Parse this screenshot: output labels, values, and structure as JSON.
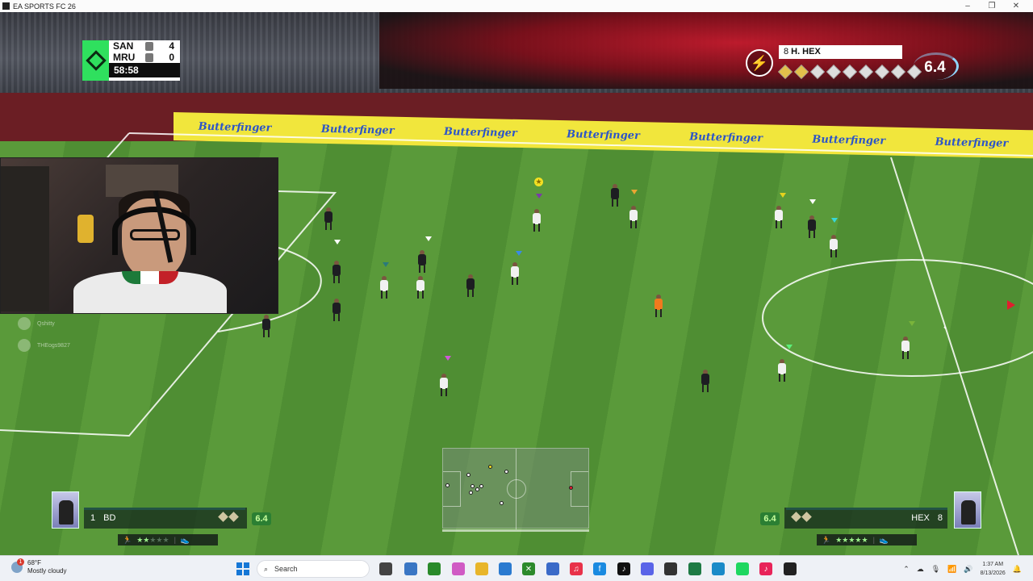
{
  "window": {
    "title": "EA SPORTS FC 26",
    "minimize": "–",
    "maximize": "❐",
    "close": "✕"
  },
  "scoreboard": {
    "home": {
      "team": "SAN",
      "score": "4"
    },
    "away": {
      "team": "MRU",
      "score": "0"
    },
    "clock": "58:58"
  },
  "player_rating": {
    "number": "8",
    "name": "H. HEX",
    "rating": "6.4",
    "icon": "lightning-icon"
  },
  "adboard": {
    "brand": "Butterfinger"
  },
  "chat": [
    {
      "user": "Qshitty"
    },
    {
      "user": "THEogs9827"
    }
  ],
  "hud_left": {
    "number": "1",
    "name": "BD",
    "rating": "6.4",
    "stars": "★★",
    "empty_stars": "★★★"
  },
  "hud_right": {
    "number": "8",
    "name": "HEX",
    "rating": "6.4",
    "stars": "★★★★★"
  },
  "taskbar": {
    "weather_temp": "68°F",
    "weather_desc": "Mostly cloudy",
    "notification_count": "1",
    "search_placeholder": "Search",
    "time": "1:37 AM",
    "date": "8/13/2026"
  },
  "colors": {
    "accent_green": "#2fe05e",
    "adboard_yellow": "#f1e63c",
    "adboard_text": "#2c55c8",
    "taskbar_bg": "#eef1f6"
  }
}
